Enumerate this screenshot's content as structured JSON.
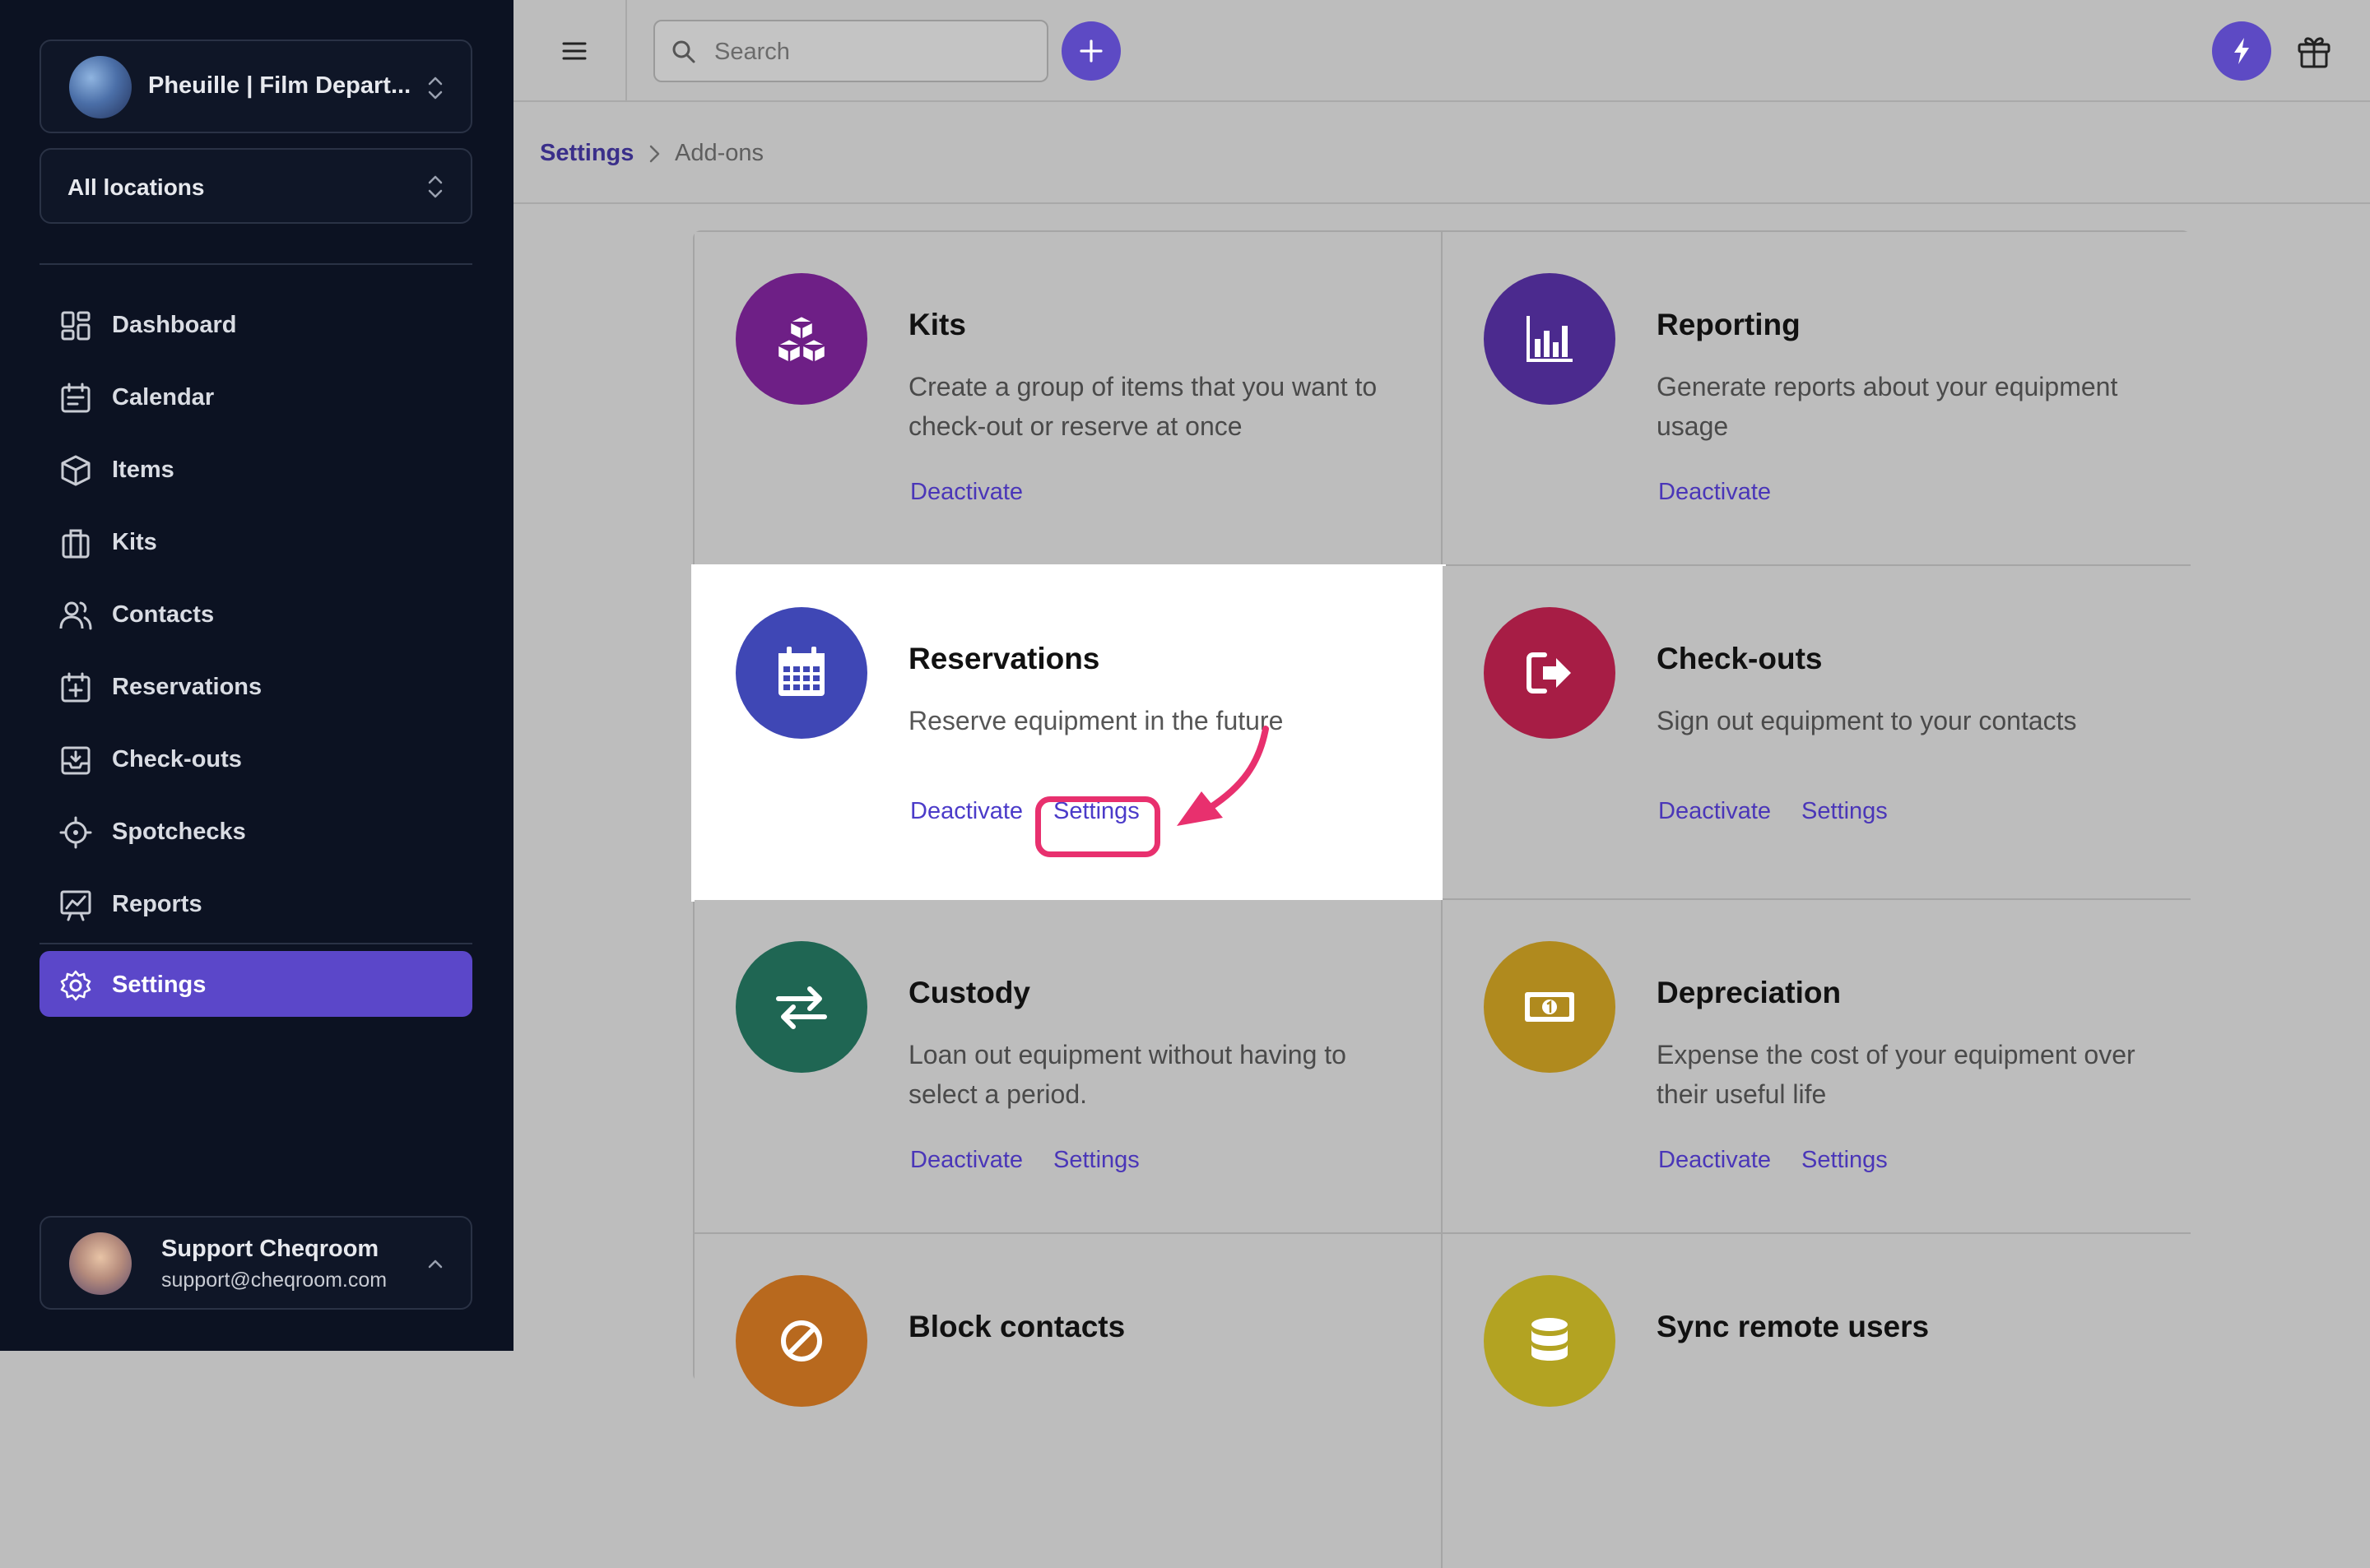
{
  "sidebar": {
    "workspace": "Pheuille | Film Depart...",
    "location": "All locations",
    "items": [
      {
        "label": "Dashboard",
        "icon": "dashboard-icon"
      },
      {
        "label": "Calendar",
        "icon": "calendar-icon"
      },
      {
        "label": "Items",
        "icon": "box-icon"
      },
      {
        "label": "Kits",
        "icon": "briefcase-icon"
      },
      {
        "label": "Contacts",
        "icon": "users-icon"
      },
      {
        "label": "Reservations",
        "icon": "calendar-plus-icon"
      },
      {
        "label": "Check-outs",
        "icon": "tray-download-icon"
      },
      {
        "label": "Spotchecks",
        "icon": "crosshair-icon"
      },
      {
        "label": "Reports",
        "icon": "presentation-chart-icon"
      },
      {
        "label": "Settings",
        "icon": "gear-icon",
        "active": true
      }
    ],
    "user": {
      "name": "Support Cheqroom",
      "email": "support@cheqroom.com"
    }
  },
  "topbar": {
    "search_placeholder": "Search"
  },
  "breadcrumb": {
    "root": "Settings",
    "current": "Add-ons"
  },
  "addons": [
    {
      "title": "Kits",
      "desc": "Create a group of items that you want to check-out or reserve at once",
      "color": "#6e1f86",
      "icon": "cubes-icon",
      "links": [
        "Deactivate"
      ]
    },
    {
      "title": "Reporting",
      "desc": "Generate reports about your equipment usage",
      "color": "#4b2a8e",
      "icon": "bar-chart-icon",
      "links": [
        "Deactivate"
      ]
    },
    {
      "title": "Reservations",
      "desc": "Reserve equipment in the future",
      "color": "#3f47b5",
      "icon": "calendar-grid-icon",
      "links": [
        "Deactivate",
        "Settings"
      ]
    },
    {
      "title": "Check-outs",
      "desc": "Sign out equipment to your contacts",
      "color": "#a71d45",
      "icon": "sign-out-icon",
      "links": [
        "Deactivate",
        "Settings"
      ]
    },
    {
      "title": "Custody",
      "desc": "Loan out equipment without having to select a period.",
      "color": "#1f6653",
      "icon": "swap-arrows-icon",
      "links": [
        "Deactivate",
        "Settings"
      ]
    },
    {
      "title": "Depreciation",
      "desc": "Expense the cost of your equipment over their useful life",
      "color": "#b08a1e",
      "icon": "banknote-icon",
      "links": [
        "Deactivate",
        "Settings"
      ]
    },
    {
      "title": "Block contacts",
      "desc": "",
      "color": "#b8691e",
      "icon": "block-icon",
      "links": []
    },
    {
      "title": "Sync remote users",
      "desc": "",
      "color": "#b3a322",
      "icon": "database-icon",
      "links": []
    }
  ],
  "colors": {
    "accent": "#5b47c9",
    "callout": "#e8306e"
  }
}
